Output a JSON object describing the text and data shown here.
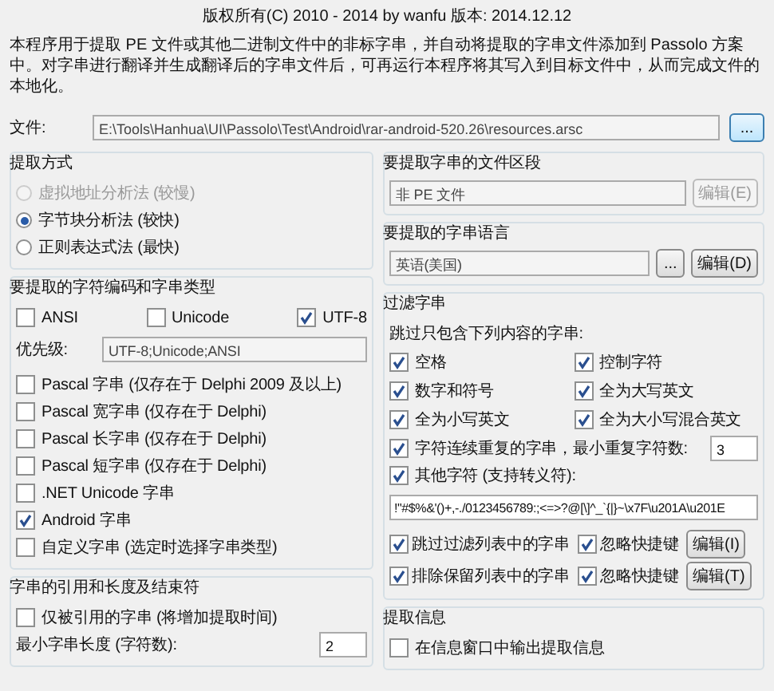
{
  "header": "版权所有(C) 2010 - 2014 by wanfu  版本: 2014.12.12",
  "description": "本程序用于提取 PE 文件或其他二进制文件中的非标字串，并自动将提取的字串文件添加到 Passolo 方案中。对字串进行翻译并生成翻译后的字串文件后，可再运行本程序将其写入到目标文件中，从而完成文件的本地化。",
  "file": {
    "label": "文件:",
    "value": "E:\\Tools\\Hanhua\\UI\\Passolo\\Test\\Android\\rar-android-520.26\\resources.arsc",
    "button": "..."
  },
  "extraction_method": {
    "title": "提取方式",
    "options": [
      {
        "label": "虚拟地址分析法 (较慢)",
        "selected": false,
        "disabled": true
      },
      {
        "label": "字节块分析法 (较快)",
        "selected": true,
        "disabled": false
      },
      {
        "label": "正则表达式法 (最快)",
        "selected": false,
        "disabled": false
      }
    ]
  },
  "encoding": {
    "title": "要提取的字符编码和字串类型",
    "checkboxes": [
      {
        "label": "ANSI",
        "checked": false
      },
      {
        "label": "Unicode",
        "checked": false
      },
      {
        "label": "UTF-8",
        "checked": true
      }
    ],
    "priority": {
      "label": "优先级:",
      "value": "UTF-8;Unicode;ANSI"
    },
    "string_types": [
      {
        "label": "Pascal 字串 (仅存在于 Delphi 2009 及以上)",
        "checked": false
      },
      {
        "label": "Pascal 宽字串 (仅存在于 Delphi)",
        "checked": false
      },
      {
        "label": "Pascal 长字串 (仅存在于 Delphi)",
        "checked": false
      },
      {
        "label": "Pascal 短字串 (仅存在于 Delphi)",
        "checked": false
      },
      {
        "label": ".NET Unicode 字串",
        "checked": false
      },
      {
        "label": "Android 字串",
        "checked": true
      },
      {
        "label": "自定义字串 (选定时选择字串类型)",
        "checked": false
      }
    ]
  },
  "quoting": {
    "title": "字串的引用和长度及结束符",
    "only_referenced": {
      "label": "仅被引用的字串 (将增加提取时间)",
      "checked": false
    },
    "min_length": {
      "label": "最小字串长度 (字符数):",
      "value": "2"
    }
  },
  "sections": {
    "title": "要提取字串的文件区段",
    "value": "非 PE 文件",
    "button": "编辑(E)",
    "disabled": true
  },
  "language": {
    "title": "要提取的字串语言",
    "value": "英语(美国)",
    "browse": "...",
    "button": "编辑(D)"
  },
  "filter": {
    "title": "过滤字串",
    "hint": "跳过只包含下列内容的字串:",
    "options": [
      {
        "label": "空格",
        "checked": true
      },
      {
        "label": "控制字符",
        "checked": true
      },
      {
        "label": "数字和符号",
        "checked": true
      },
      {
        "label": "全为大写英文",
        "checked": true
      },
      {
        "label": "全为小写英文",
        "checked": true
      },
      {
        "label": "全为大小写混合英文",
        "checked": true
      }
    ],
    "repeat": {
      "label": "字符连续重复的字串，最小重复字符数:",
      "checked": true,
      "value": "3"
    },
    "other": {
      "label": "其他字符 (支持转义符):",
      "checked": true
    },
    "chars": "!\"#$%&'()+,-./0123456789:;<=>?@[\\]^_`{|}~\\x7F\\u201A\\u201E",
    "lists": [
      {
        "label": "跳过过滤列表中的字串",
        "checked": true,
        "ignore_label": "忽略快捷键",
        "ignore_checked": true,
        "button": "编辑(I)"
      },
      {
        "label": "排除保留列表中的字串",
        "checked": true,
        "ignore_label": "忽略快捷键",
        "ignore_checked": true,
        "button": "编辑(T)"
      }
    ]
  },
  "info": {
    "title": "提取信息",
    "options": [
      {
        "label": "在信息窗口中输出提取信息",
        "checked": false
      }
    ]
  }
}
